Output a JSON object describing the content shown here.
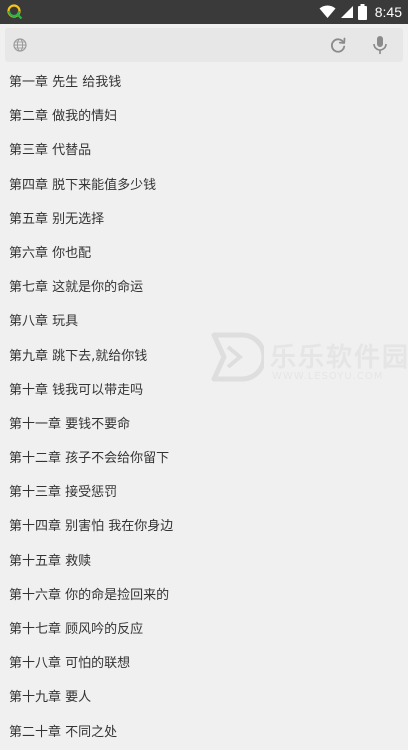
{
  "status_bar": {
    "time": "8:45",
    "icons": [
      "app-icon",
      "wifi-icon",
      "signal-icon",
      "battery-icon"
    ]
  },
  "search_bar": {
    "value": "",
    "icons": [
      "globe-icon",
      "refresh-icon",
      "microphone-icon"
    ]
  },
  "chapters": [
    "第一章 先生 给我钱",
    "第二章 做我的情妇",
    "第三章 代替品",
    "第四章 脱下来能值多少钱",
    "第五章 别无选择",
    "第六章 你也配",
    "第七章 这就是你的命运",
    "第八章 玩具",
    "第九章 跳下去,就给你钱",
    "第十章 钱我可以带走吗",
    "第十一章 要钱不要命",
    "第十二章 孩子不会给你留下",
    "第十三章 接受惩罚",
    "第十四章 别害怕 我在你身边",
    "第十五章 救赎",
    "第十六章 你的命是捡回来的",
    "第十七章 顾风吟的反应",
    "第十八章 可怕的联想",
    "第十九章 要人",
    "第二十章 不同之处"
  ],
  "watermark": {
    "text": "乐乐软件园",
    "url": "WWW.LESOYU.COM"
  },
  "colors": {
    "status_bar_bg": "#3a3a3a",
    "page_bg": "#f0f0f0",
    "search_box_bg": "#e7e7e7",
    "text": "#333333",
    "icon": "#9a9a9a"
  }
}
